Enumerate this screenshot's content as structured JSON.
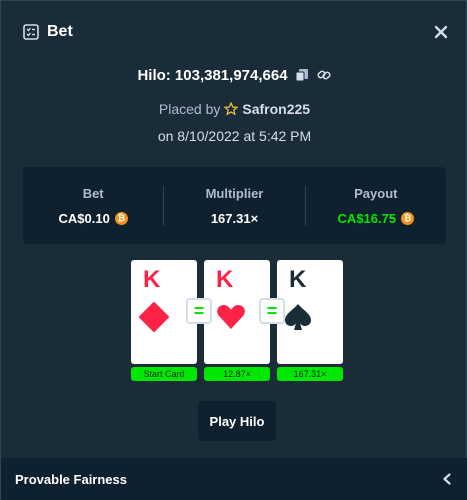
{
  "header": {
    "title": "Bet",
    "icon": "bet-slip-icon",
    "close_icon": "close-icon"
  },
  "bet": {
    "game_label": "Hilo: 103,381,974,664",
    "placed_by_prefix": "Placed by",
    "username": "Safron225",
    "date_text": "on 8/10/2022 at 5:42 PM"
  },
  "stats": {
    "bet_label": "Bet",
    "bet_value": "CA$0.10",
    "multiplier_label": "Multiplier",
    "multiplier_value": "167.31×",
    "payout_label": "Payout",
    "payout_value": "CA$16.75",
    "currency_icon": "bitcoin-icon"
  },
  "cards": [
    {
      "rank": "K",
      "suit": "diamond",
      "label": "Start Card"
    },
    {
      "rank": "K",
      "suit": "heart",
      "label": "12.87×"
    },
    {
      "rank": "K",
      "suit": "spade",
      "label": "167.31×"
    }
  ],
  "guess_symbol": "=",
  "play_button": "Play Hilo",
  "footer": {
    "label": "Provable Fairness"
  },
  "colors": {
    "background": "#1a2c38",
    "panel": "#0f212e",
    "green": "#00e701",
    "red_suit": "#fe2247",
    "muted_text": "#b1bad3"
  }
}
